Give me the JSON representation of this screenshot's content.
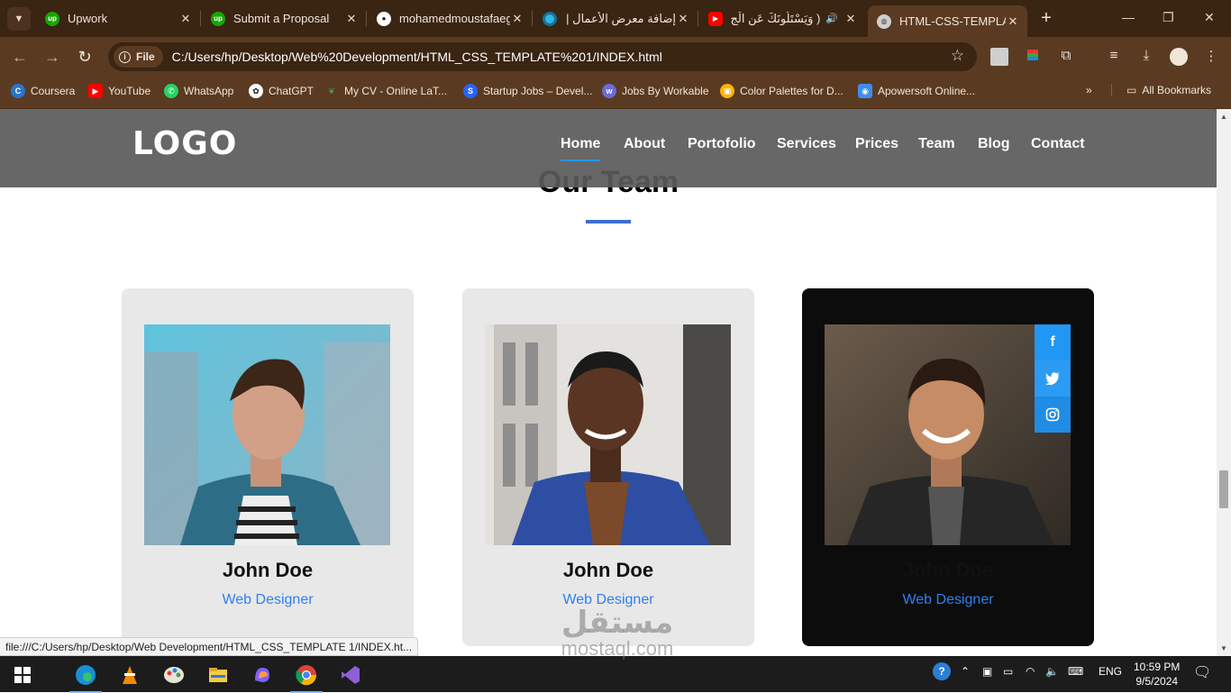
{
  "browser": {
    "tabs": [
      {
        "title": "Upwork",
        "icon": "upwork-icon",
        "color": "#14a800"
      },
      {
        "title": "Submit a Proposal",
        "icon": "upwork-icon",
        "color": "#14a800"
      },
      {
        "title": "mohamedmoustafaeg",
        "icon": "github-icon",
        "color": "#ffffff"
      },
      {
        "title": "إضافة معرض الأعمال |",
        "icon": "mostaql-icon",
        "color": "#2db6e8"
      },
      {
        "title": "( وَيَسْتَلُونَكَ عَنِ الْجِ",
        "icon": "youtube-icon",
        "color": "#ff0000"
      },
      {
        "title": "HTML-CSS-TEMPLATE",
        "icon": "globe-icon",
        "color": "#cfcfcf"
      }
    ],
    "address": {
      "chip": "File",
      "url": "C:/Users/hp/Desktop/Web%20Development/HTML_CSS_TEMPLATE%201/INDEX.html"
    },
    "bookmarks": [
      {
        "label": "Coursera",
        "icon": "coursera-icon",
        "color": "#2a73cc"
      },
      {
        "label": "YouTube",
        "icon": "youtube-icon",
        "color": "#ff0000"
      },
      {
        "label": "WhatsApp",
        "icon": "whatsapp-icon",
        "color": "#25d366"
      },
      {
        "label": "ChatGPT",
        "icon": "chatgpt-icon",
        "color": "#ffffff"
      },
      {
        "label": "My CV - Online LaT...",
        "icon": "overleaf-icon",
        "color": "#4f9c45"
      },
      {
        "label": "Startup Jobs – Devel...",
        "icon": "startup-jobs-icon",
        "color": "#2962ff"
      },
      {
        "label": "Jobs By Workable",
        "icon": "workable-icon",
        "color": "#6b6bd6"
      },
      {
        "label": "Color Palettes for D...",
        "icon": "color-palette-icon",
        "color": "#ffb300"
      },
      {
        "label": "Apowersoft Online...",
        "icon": "apowersoft-icon",
        "color": "#3f8cf2"
      }
    ],
    "all_bookmarks": "All Bookmarks",
    "status_url": "file:///C:/Users/hp/Desktop/Web Development/HTML_CSS_TEMPLATE 1/INDEX.ht..."
  },
  "site": {
    "logo": "LOGO",
    "nav": [
      "Home",
      "About",
      "Portofolio",
      "Services",
      "Prices",
      "Team",
      "Blog",
      "Contact"
    ],
    "active_nav": "Home",
    "section_title": "Our Team",
    "accent": "#2196f3",
    "members": [
      {
        "name": "John Doe",
        "role": "Web Designer",
        "theme": "light"
      },
      {
        "name": "John Doe",
        "role": "Web Designer",
        "theme": "light"
      },
      {
        "name": "John Doe",
        "role": "Web Designer",
        "theme": "dark",
        "social": [
          "facebook-icon",
          "twitter-icon",
          "instagram-icon"
        ]
      }
    ]
  },
  "watermark": {
    "arabic": "مستقل",
    "latin": "mostaql.com"
  },
  "taskbar": {
    "lang": "ENG",
    "time": "10:59 PM",
    "date": "9/5/2024"
  }
}
